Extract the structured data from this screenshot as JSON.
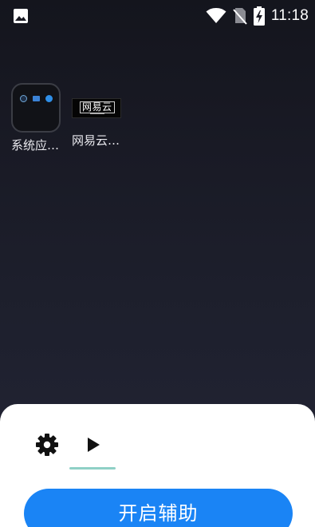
{
  "status_bar": {
    "time": "11:18",
    "icons": [
      "image-notification-icon",
      "wifi-icon",
      "no-sim-icon",
      "battery-charging-icon"
    ]
  },
  "home": {
    "apps": [
      {
        "label": "系统应…",
        "icon": "folder-icon"
      },
      {
        "label": "网易云…",
        "icon": "netease-cloud-icon",
        "icon_text": "网易云"
      }
    ]
  },
  "panel": {
    "tabs": [
      {
        "icon": "gear-icon",
        "selected": false
      },
      {
        "icon": "play-icon",
        "selected": true
      }
    ],
    "primary_button_label": "开启辅助",
    "colors": {
      "accent": "#1a84f5",
      "tab_indicator": "#8fd0c6"
    }
  }
}
